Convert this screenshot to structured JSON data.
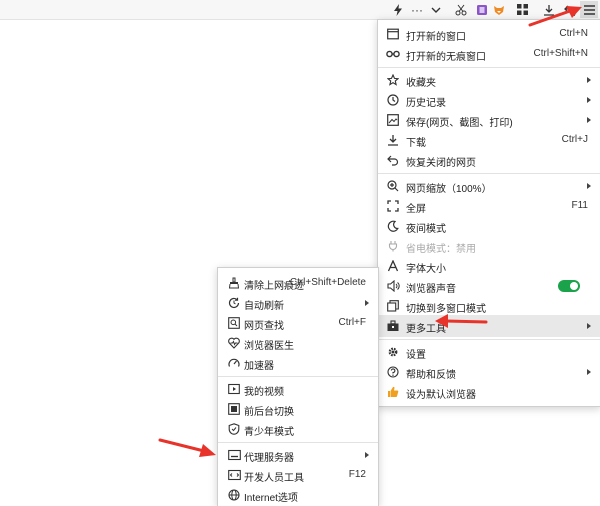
{
  "toolbar": {
    "icons": [
      "lightning-icon",
      "more-dots-icon",
      "chevron-down-icon",
      "scissors-icon",
      "extension-purple-icon",
      "extension-fox-icon",
      "apps-grid-icon",
      "download-icon",
      "undo-icon",
      "menu-icon"
    ],
    "more_glyph": "···"
  },
  "main_menu": {
    "items": [
      {
        "label": "打开新的窗口",
        "shortcut": "Ctrl+N"
      },
      {
        "label": "打开新的无痕窗口",
        "shortcut": "Ctrl+Shift+N"
      },
      {
        "label": "收藏夹",
        "shortcut": ""
      },
      {
        "label": "历史记录",
        "shortcut": ""
      },
      {
        "label": "保存(网页、截图、打印)",
        "shortcut": ""
      },
      {
        "label": "下载",
        "shortcut": "Ctrl+J"
      },
      {
        "label": "恢复关闭的网页",
        "shortcut": ""
      },
      {
        "label": "网页缩放（100%）",
        "shortcut": ""
      },
      {
        "label": "全屏",
        "shortcut": "F11"
      },
      {
        "label": "夜间模式",
        "shortcut": ""
      },
      {
        "label": "省电模式：禁用",
        "shortcut": ""
      },
      {
        "label": "字体大小",
        "shortcut": ""
      },
      {
        "label": "浏览器声音",
        "shortcut": ""
      },
      {
        "label": "切换到多窗口模式",
        "shortcut": ""
      },
      {
        "label": "更多工具",
        "shortcut": ""
      },
      {
        "label": "设置",
        "shortcut": ""
      },
      {
        "label": "帮助和反馈",
        "shortcut": ""
      },
      {
        "label": "设为默认浏览器",
        "shortcut": ""
      }
    ],
    "sound_enabled": true
  },
  "tools_menu": {
    "items": [
      {
        "label": "清除上网痕迹",
        "shortcut": "Ctrl+Shift+Delete"
      },
      {
        "label": "自动刷新",
        "shortcut": ""
      },
      {
        "label": "网页查找",
        "shortcut": "Ctrl+F"
      },
      {
        "label": "浏览器医生",
        "shortcut": ""
      },
      {
        "label": "加速器",
        "shortcut": ""
      },
      {
        "label": "我的视频",
        "shortcut": ""
      },
      {
        "label": "前后台切换",
        "shortcut": ""
      },
      {
        "label": "青少年模式",
        "shortcut": ""
      },
      {
        "label": "代理服务器",
        "shortcut": ""
      },
      {
        "label": "开发人员工具",
        "shortcut": "F12"
      },
      {
        "label": "Internet选项",
        "shortcut": ""
      }
    ]
  },
  "colors": {
    "annotation_arrow": "#e8332a",
    "toggle_on": "#1aa34a",
    "highlight": "#e8e8e8"
  }
}
